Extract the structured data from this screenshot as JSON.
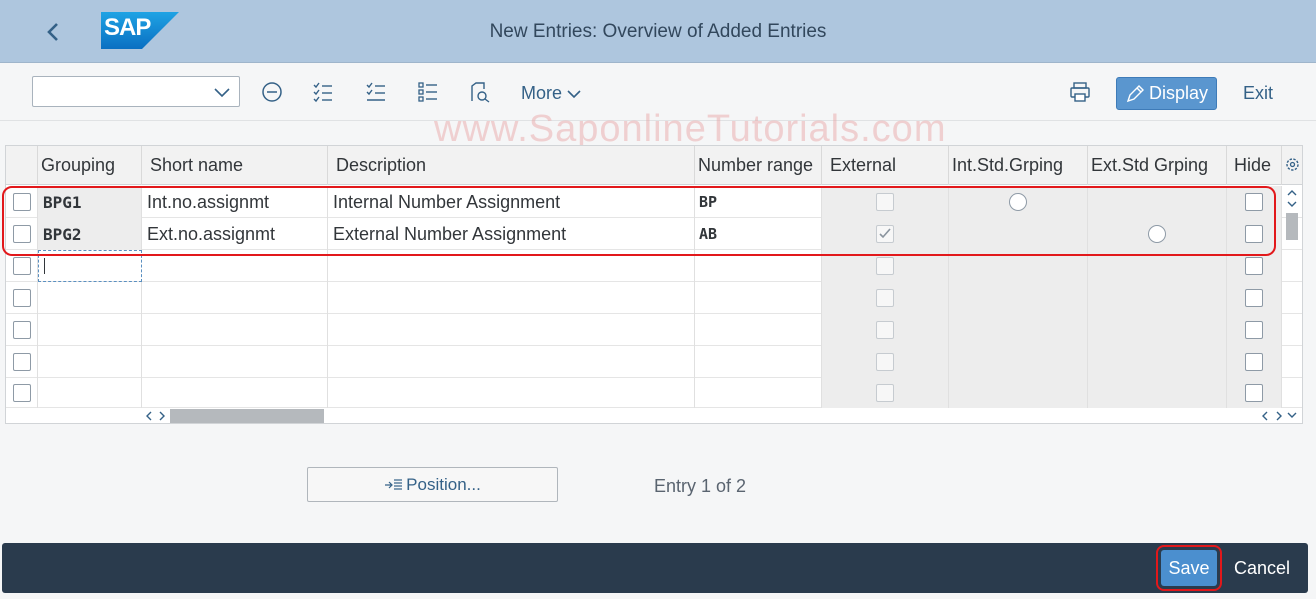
{
  "header": {
    "title": "New Entries: Overview of Added Entries",
    "logo_text": "SAP",
    "back_icon": "chevron-left-icon",
    "background": "#aec6de"
  },
  "toolbar": {
    "select_value": "",
    "more_label": "More",
    "display_label": "Display",
    "exit_label": "Exit",
    "icons": [
      "minus-circle-icon",
      "select-all-icon",
      "deselect-all-icon",
      "select-block-icon",
      "details-icon",
      "print-icon"
    ]
  },
  "watermark": "www.SaponlineTutorials.com",
  "table": {
    "columns": [
      "Grouping",
      "Short name",
      "Description",
      "Number range",
      "External",
      "Int.Std.Grping",
      "Ext.Std Grping",
      "Hide"
    ],
    "rows": [
      {
        "grouping": "BPG1",
        "short_name": "Int.no.assignmt",
        "description": "Internal Number Assignment",
        "number_range": "BP",
        "external": false,
        "int_std": true,
        "ext_std": false,
        "hide": false
      },
      {
        "grouping": "BPG2",
        "short_name": "Ext.no.assignmt",
        "description": "External Number Assignment",
        "number_range": "AB",
        "external": true,
        "int_std": false,
        "ext_std": true,
        "hide": false
      }
    ],
    "empty_rows": 5
  },
  "footer": {
    "position_label": "Position...",
    "entry_info": "Entry 1 of 2"
  },
  "bottom_bar": {
    "save_label": "Save",
    "cancel_label": "Cancel"
  },
  "colors": {
    "accent": "#4b8fcf",
    "highlight": "#e2181b",
    "bottom_bar": "#2a3b4d"
  }
}
